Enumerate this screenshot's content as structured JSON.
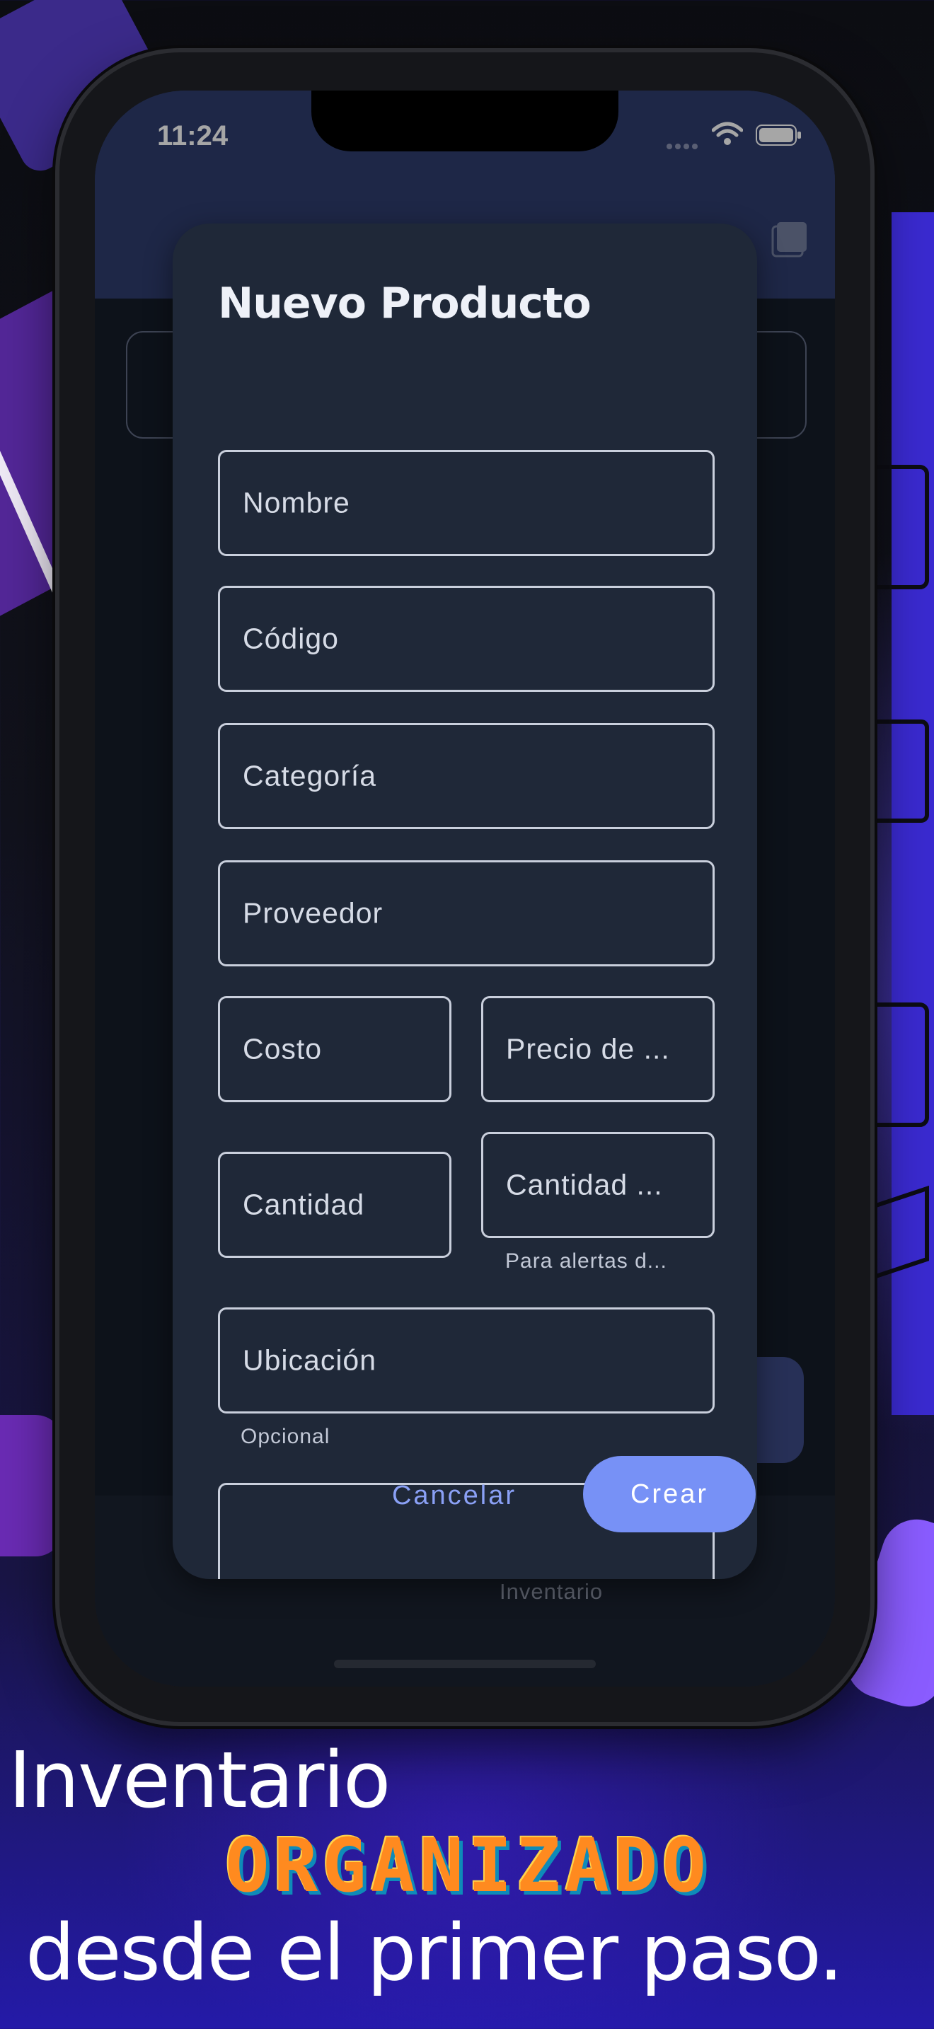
{
  "status_bar": {
    "time": "11:24"
  },
  "app": {
    "bottom_nav_active_label": "Inventario"
  },
  "dialog": {
    "title": "Nuevo Producto",
    "fields": {
      "nombre": "Nombre",
      "codigo": "Código",
      "categoria": "Categoría",
      "proveedor": "Proveedor",
      "costo": "Costo",
      "precio": "Precio de ...",
      "cantidad": "Cantidad",
      "cantidad_minima": "Cantidad ...",
      "cantidad_minima_helper": "Para alertas d...",
      "ubicacion": "Ubicación",
      "ubicacion_helper": "Opcional"
    },
    "actions": {
      "cancel": "Cancelar",
      "create": "Crear"
    }
  },
  "tagline": {
    "line1": "Inventario",
    "line2": "ORGANIZADO",
    "line3": "desde el primer paso."
  },
  "colors": {
    "dialog_bg": "#1f2838",
    "app_header": "#2f3d6e",
    "primary_button": "#7791f6",
    "accent_orange": "#ff8a1f"
  }
}
